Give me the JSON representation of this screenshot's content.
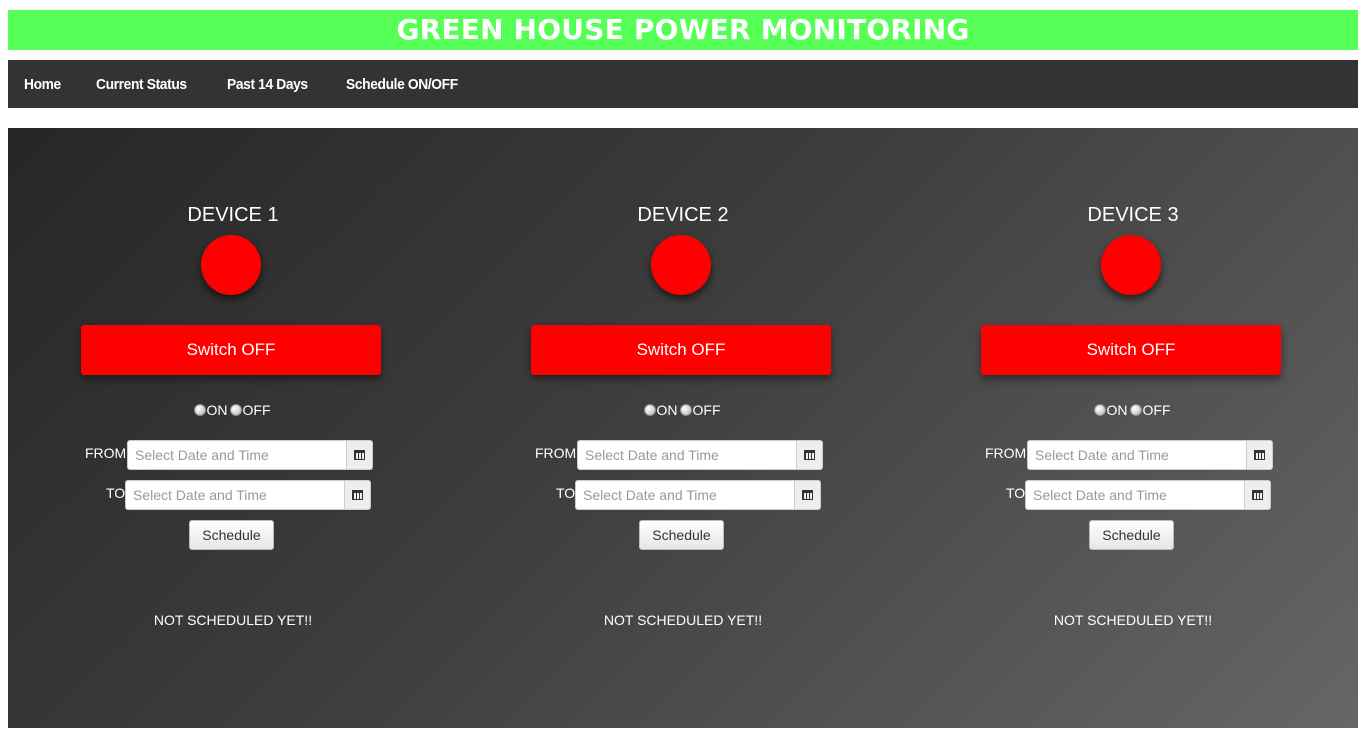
{
  "header": {
    "title": "GREEN HOUSE POWER MONITORING"
  },
  "nav": {
    "items": [
      {
        "label": "Home"
      },
      {
        "label": "Current Status"
      },
      {
        "label": "Past 14 Days"
      },
      {
        "label": "Schedule ON/OFF"
      }
    ]
  },
  "colors": {
    "header_bg": "#55ff55",
    "nav_bg": "#333333",
    "device_off": "#ff0000"
  },
  "devices": [
    {
      "title": "DEVICE 1",
      "switch_label": "Switch OFF",
      "radio_on": "ON",
      "radio_off": "OFF",
      "from_label": "FROM",
      "to_label": "TO",
      "from_placeholder": "Select Date and Time",
      "to_placeholder": "Select Date and Time",
      "schedule_label": "Schedule",
      "status": "NOT SCHEDULED YET!!"
    },
    {
      "title": "DEVICE 2",
      "switch_label": "Switch OFF",
      "radio_on": "ON",
      "radio_off": "OFF",
      "from_label": "FROM",
      "to_label": "TO",
      "from_placeholder": "Select Date and Time",
      "to_placeholder": "Select Date and Time",
      "schedule_label": "Schedule",
      "status": "NOT SCHEDULED YET!!"
    },
    {
      "title": "DEVICE 3",
      "switch_label": "Switch OFF",
      "radio_on": "ON",
      "radio_off": "OFF",
      "from_label": "FROM",
      "to_label": "TO",
      "from_placeholder": "Select Date and Time",
      "to_placeholder": "Select Date and Time",
      "schedule_label": "Schedule",
      "status": "NOT SCHEDULED YET!!"
    }
  ]
}
